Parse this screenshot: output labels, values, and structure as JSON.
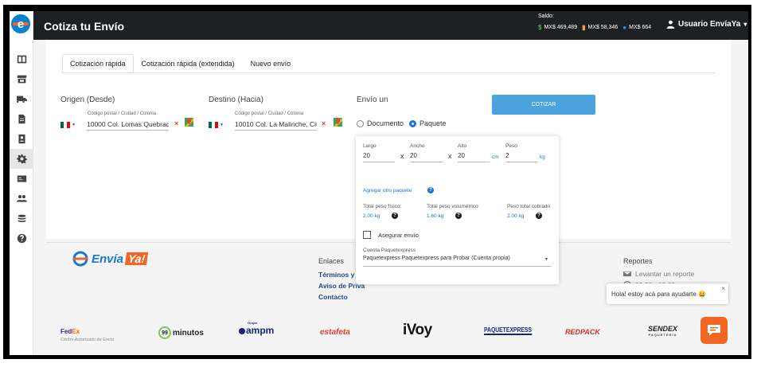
{
  "header": {
    "title": "Cotiza tu Envío",
    "saldo_label": "Saldo:",
    "balances": [
      {
        "icon": "dollar-icon",
        "symbol": "$",
        "value": "MX$ 469,489",
        "color": "#4caf50"
      },
      {
        "icon": "flag-icon",
        "symbol": "▮",
        "value": "MX$ 58,346",
        "color": "#f5a623"
      },
      {
        "icon": "globe-icon",
        "symbol": "●",
        "value": "MX$ 664",
        "color": "#2196f3"
      }
    ],
    "user_name": "Usuario EnvíaYa",
    "user_caret": "▾"
  },
  "tabs": [
    {
      "label": "Cotización rápida",
      "active": true
    },
    {
      "label": "Cotización rápida (extendida)",
      "active": false
    },
    {
      "label": "Nuevo envío",
      "active": false
    }
  ],
  "origin": {
    "label": "Origen (Desde)",
    "field_label": "Código postal / Ciudad / Colonia",
    "value": "10000 Col. Lomas Quebrad",
    "clear": "×"
  },
  "destination": {
    "label": "Destino (Hacia)",
    "field_label": "Código postal / Ciudad / Colonia",
    "value": "10010 Col. La Malinche, Ciu",
    "clear": "×"
  },
  "shipment": {
    "label": "Envío un",
    "options": [
      {
        "label": "Documento",
        "selected": false
      },
      {
        "label": "Paquete",
        "selected": true
      }
    ]
  },
  "cotizar_label": "COTIZAR",
  "package": {
    "largo_label": "Largo",
    "largo": "20",
    "ancho_label": "Ancho",
    "ancho": "20",
    "alto_label": "Alto",
    "alto": "20",
    "peso_label": "Peso",
    "peso": "2",
    "times": "x",
    "unit_cm": "cm",
    "unit_kg": "kg",
    "add_package": "Agregar otro paquete",
    "help": "?",
    "total_fisico_label": "Total peso físico:",
    "total_fisico": "2.00 kg",
    "total_vol_label": "Total peso volumétrico:",
    "total_vol": "1.60 kg",
    "total_cobrado_label": "Peso total cobrado",
    "total_cobrado": "2.00 kg",
    "insure_label": "Asegurar envío",
    "account_label": "Cuenta Paquetexpress",
    "account_value": "Paquetexpress Paquetexpress para Probar (Cuenta propia)",
    "account_caret": "▼"
  },
  "footer": {
    "brand_env": "Envía",
    "brand_ya": "Ya!",
    "links_title": "Enlaces",
    "links": [
      "Términos y co",
      "Aviso de Priva",
      "Contacto"
    ],
    "reports_title": "Reportes",
    "report_link": "Levantar un reporte",
    "hours": "09:00 - 19:00"
  },
  "chat": {
    "bubble": "Hola! estoy acá para ayudarte 😀",
    "close": "×"
  },
  "carriers": {
    "fedex_a": "Fed",
    "fedex_b": "Ex",
    "fedex_sub": "Centro Autorizado de Envío",
    "minutos_num": "99",
    "minutos": "minutos",
    "ampm_grupo": "Grupo",
    "ampm": "ampm",
    "estafeta": "estafeta",
    "ivoy": "iVoy",
    "paquetexpress": "PAQUETEXPRESS",
    "redpack": "REDPACK",
    "sendex": "SENDEX",
    "sendex_sub": "PAQUETERÍA"
  }
}
